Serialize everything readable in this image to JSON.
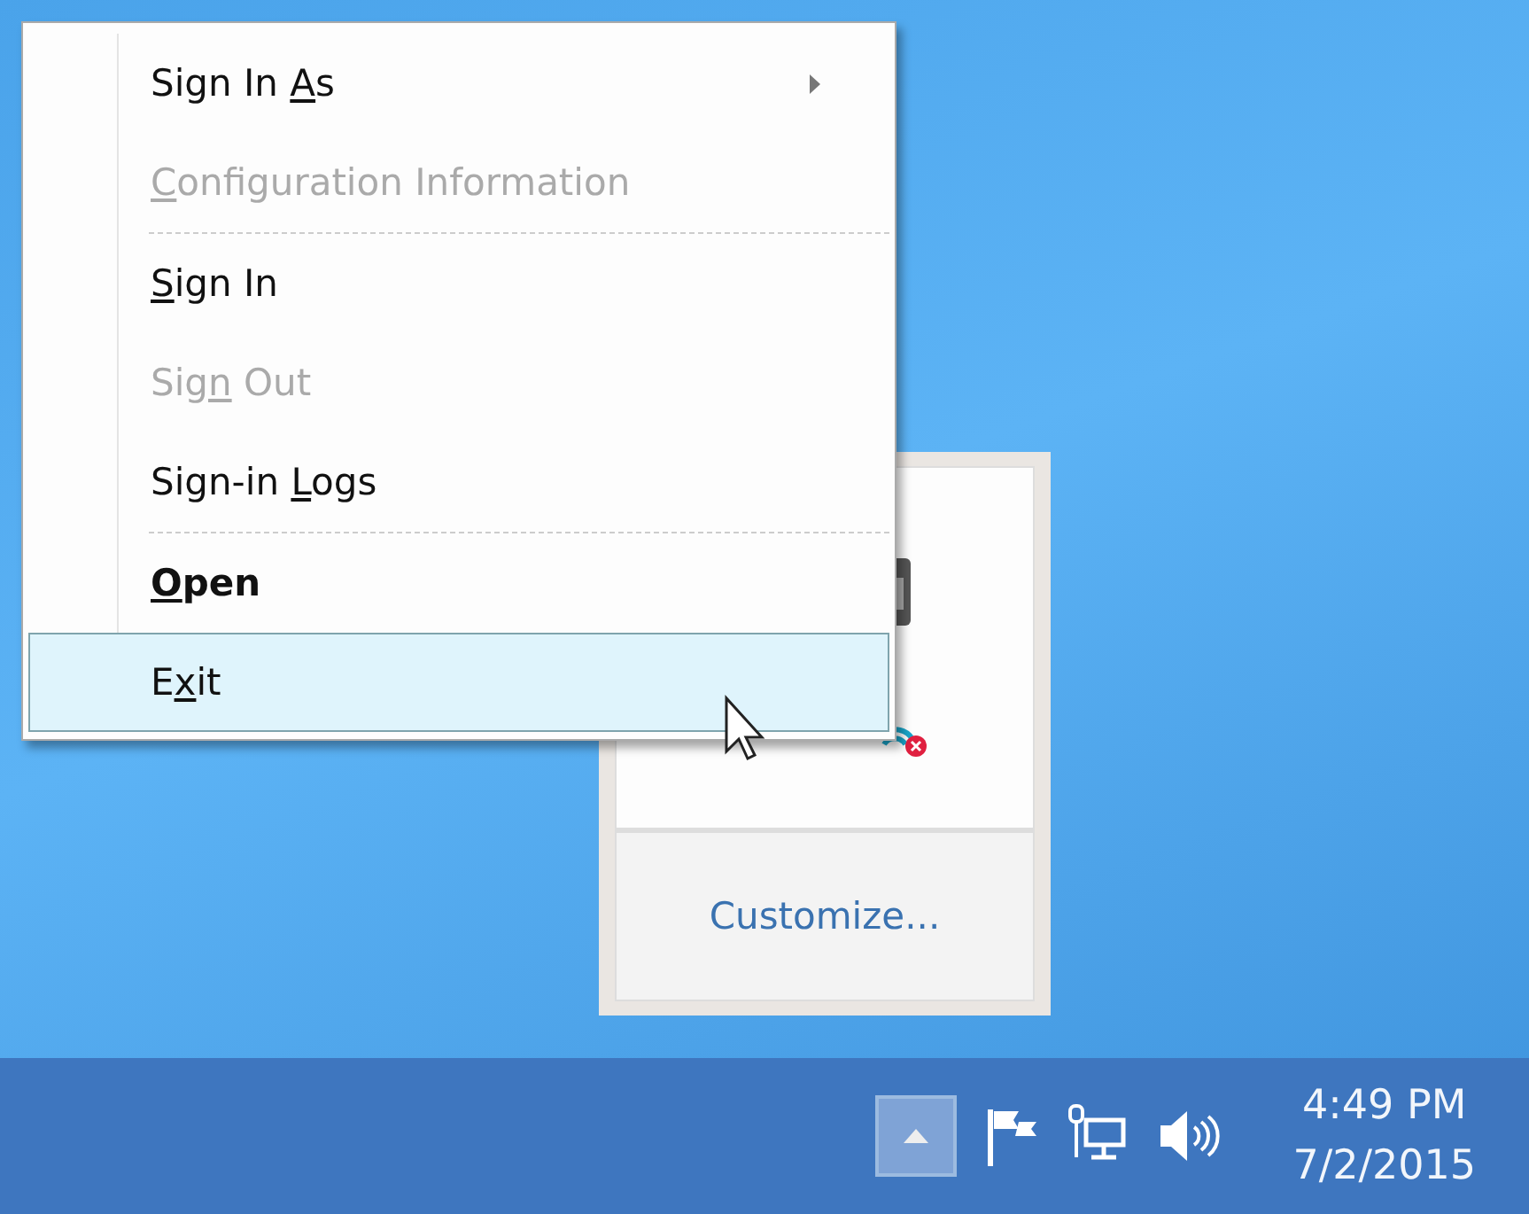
{
  "context_menu": {
    "items": [
      {
        "kind": "item",
        "label_before": "Sign In ",
        "access_key": "A",
        "label_after": "s",
        "disabled": false,
        "bold": false,
        "submenu": true,
        "selected": false
      },
      {
        "kind": "item",
        "access_key": "C",
        "label_after": "onfiguration Information",
        "disabled": true,
        "bold": false,
        "submenu": false,
        "selected": false
      },
      {
        "kind": "separator"
      },
      {
        "kind": "item",
        "access_key": "S",
        "label_after": "ign In",
        "disabled": false,
        "bold": false,
        "submenu": false,
        "selected": false
      },
      {
        "kind": "item",
        "label_before": "Sig",
        "access_key": "n",
        "label_after": " Out",
        "disabled": true,
        "bold": false,
        "submenu": false,
        "selected": false
      },
      {
        "kind": "item",
        "label_before": "Sign-in ",
        "access_key": "L",
        "label_after": "ogs",
        "disabled": false,
        "bold": false,
        "submenu": false,
        "selected": false
      },
      {
        "kind": "separator"
      },
      {
        "kind": "item",
        "access_key": "O",
        "label_after": "pen",
        "disabled": false,
        "bold": true,
        "submenu": false,
        "selected": false
      },
      {
        "kind": "item",
        "label_before": "E",
        "access_key": "x",
        "label_after": "it",
        "disabled": false,
        "bold": false,
        "submenu": false,
        "selected": true
      }
    ]
  },
  "tray_overflow": {
    "link": "Customize..."
  },
  "taskbar": {
    "show_hidden_selected": true,
    "time": "4:49 PM",
    "date": "7/2/2015"
  }
}
